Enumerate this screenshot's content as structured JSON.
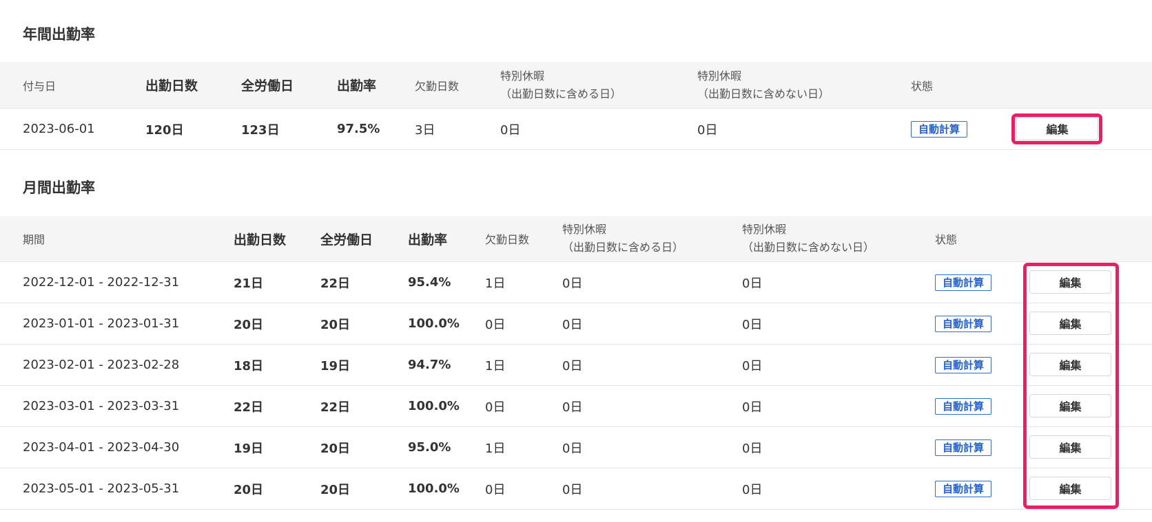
{
  "annual": {
    "title": "年間出勤率",
    "headers": {
      "grant_date": "付与日",
      "work_days": "出勤日数",
      "total_work_days": "全労働日",
      "rate": "出勤率",
      "absent_days": "欠勤日数",
      "special_inc_1": "特別休暇",
      "special_inc_2": "（出勤日数に含める日）",
      "special_exc_1": "特別休暇",
      "special_exc_2": "（出勤日数に含めない日）",
      "status": "状態"
    },
    "rows": [
      {
        "grant_date": "2023-06-01",
        "work_days": "120日",
        "total_work_days": "123日",
        "rate": "97.5%",
        "absent_days": "3日",
        "special_inc": "0日",
        "special_exc": "0日",
        "status": "自動計算",
        "edit_label": "編集"
      }
    ]
  },
  "monthly": {
    "title": "月間出勤率",
    "headers": {
      "period": "期間",
      "work_days": "出勤日数",
      "total_work_days": "全労働日",
      "rate": "出勤率",
      "absent_days": "欠勤日数",
      "special_inc_1": "特別休暇",
      "special_inc_2": "（出勤日数に含める日）",
      "special_exc_1": "特別休暇",
      "special_exc_2": "（出勤日数に含めない日）",
      "status": "状態"
    },
    "rows": [
      {
        "period": "2022-12-01 - 2022-12-31",
        "work_days": "21日",
        "total_work_days": "22日",
        "rate": "95.4%",
        "absent_days": "1日",
        "special_inc": "0日",
        "special_exc": "0日",
        "status": "自動計算",
        "edit_label": "編集"
      },
      {
        "period": "2023-01-01 - 2023-01-31",
        "work_days": "20日",
        "total_work_days": "20日",
        "rate": "100.0%",
        "absent_days": "0日",
        "special_inc": "0日",
        "special_exc": "0日",
        "status": "自動計算",
        "edit_label": "編集"
      },
      {
        "period": "2023-02-01 - 2023-02-28",
        "work_days": "18日",
        "total_work_days": "19日",
        "rate": "94.7%",
        "absent_days": "1日",
        "special_inc": "0日",
        "special_exc": "0日",
        "status": "自動計算",
        "edit_label": "編集"
      },
      {
        "period": "2023-03-01 - 2023-03-31",
        "work_days": "22日",
        "total_work_days": "22日",
        "rate": "100.0%",
        "absent_days": "0日",
        "special_inc": "0日",
        "special_exc": "0日",
        "status": "自動計算",
        "edit_label": "編集"
      },
      {
        "period": "2023-04-01 - 2023-04-30",
        "work_days": "19日",
        "total_work_days": "20日",
        "rate": "95.0%",
        "absent_days": "1日",
        "special_inc": "0日",
        "special_exc": "0日",
        "status": "自動計算",
        "edit_label": "編集"
      },
      {
        "period": "2023-05-01 - 2023-05-31",
        "work_days": "20日",
        "total_work_days": "20日",
        "rate": "100.0%",
        "absent_days": "0日",
        "special_inc": "0日",
        "special_exc": "0日",
        "status": "自動計算",
        "edit_label": "編集"
      }
    ]
  },
  "colors": {
    "highlight": "#ea1f63",
    "badge": "#2561c9",
    "header_bg": "#f6f5f5"
  }
}
